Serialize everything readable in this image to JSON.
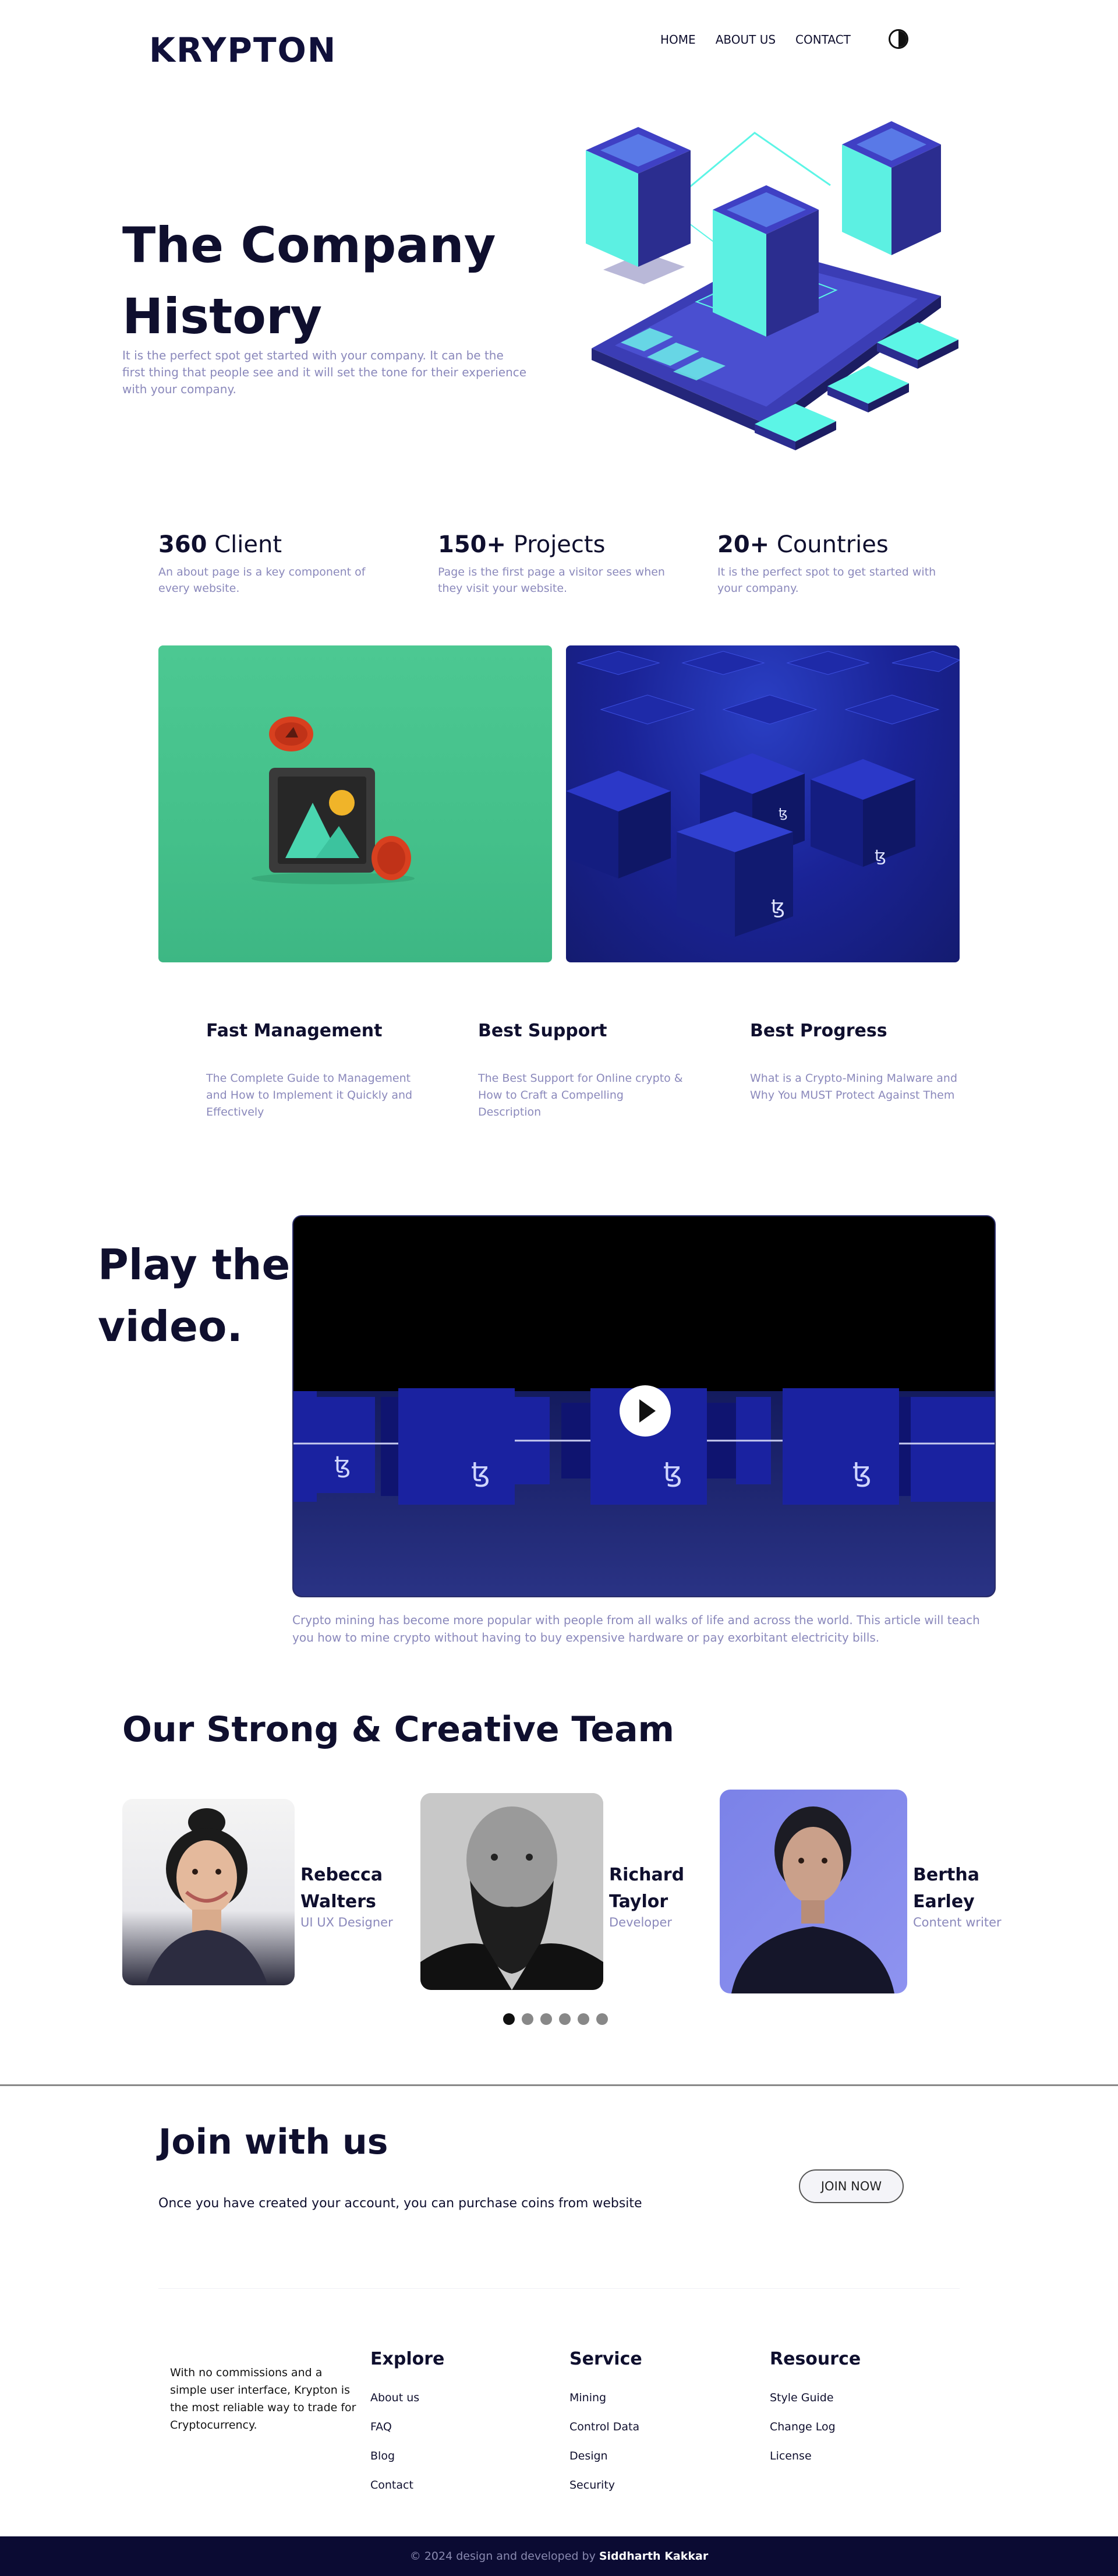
{
  "header": {
    "logo": "KRYPTON",
    "nav": [
      "HOME",
      "ABOUT US",
      "CONTACT"
    ],
    "theme_toggle_icon": "contrast-icon"
  },
  "hero": {
    "title_line1": "The Company",
    "title_line2": "History",
    "subtitle": "It is the perfect spot get started with your company. It can be the first thing that people see and it will set the tone for their experience with your company.",
    "illustration_icon": "isometric-server-icon"
  },
  "stats": [
    {
      "number": "360",
      "label": "Client",
      "desc": "An about page is a key component of every website."
    },
    {
      "number": "150+",
      "label": "Projects",
      "desc": "Page is the first page a visitor sees when they visit your website."
    },
    {
      "number": "20+",
      "label": "Countries",
      "desc": "It is the perfect spot to get started with your company."
    }
  ],
  "images": {
    "left_icon": "nft-frame-icon",
    "right_icon": "tezos-cubes-icon"
  },
  "features": [
    {
      "title": "Fast Management",
      "desc": "The Complete Guide to Management and How to Implement it Quickly and Effectively"
    },
    {
      "title": "Best Support",
      "desc": "The Best Support for Online crypto & How to Craft a Compelling Description"
    },
    {
      "title": "Best Progress",
      "desc": "What is a Crypto-Mining Malware and Why You MUST Protect Against Them"
    }
  ],
  "video": {
    "title_line1": "Play the",
    "title_line2": "video.",
    "caption": "Crypto mining has become more popular with people from all walks of life and across the world. This article will teach you how to mine crypto without having to buy expensive hardware or pay exorbitant electricity bills.",
    "tezos_glyph": "ꜩ"
  },
  "team": {
    "title": "Our Strong & Creative Team",
    "members": [
      {
        "first": "Rebecca",
        "last": "Walters",
        "role": "UI UX Designer"
      },
      {
        "first": "Richard",
        "last": "Taylor",
        "role": "Developer"
      },
      {
        "first": "Bertha",
        "last": "Earley",
        "role": "Content writer"
      }
    ],
    "page_count": 6,
    "active_page": 1
  },
  "join": {
    "title": "Join with us",
    "subtitle": "Once you have created your account, you can purchase coins from website",
    "button": "JOIN NOW"
  },
  "footer": {
    "about": "With no commissions and a simple user interface, Krypton is the most reliable way to trade for Cryptocurrency.",
    "columns": [
      {
        "title": "Explore",
        "links": [
          "About us",
          "FAQ",
          "Blog",
          "Contact"
        ]
      },
      {
        "title": "Service",
        "links": [
          "Mining",
          "Control Data",
          "Design",
          "Security"
        ]
      },
      {
        "title": "Resource",
        "links": [
          "Style Guide",
          "Change Log",
          "License"
        ]
      }
    ],
    "copyright_prefix": "© 2024 design and developed by",
    "copyright_author": "Siddharth Kakkar"
  },
  "colors": {
    "navy": "#0f0f2e",
    "muted": "#8a88bb",
    "cyan": "#5cf5e6",
    "indigo": "#2b2d8f",
    "green": "#4cc892",
    "footer_bg": "#0b0b33"
  }
}
